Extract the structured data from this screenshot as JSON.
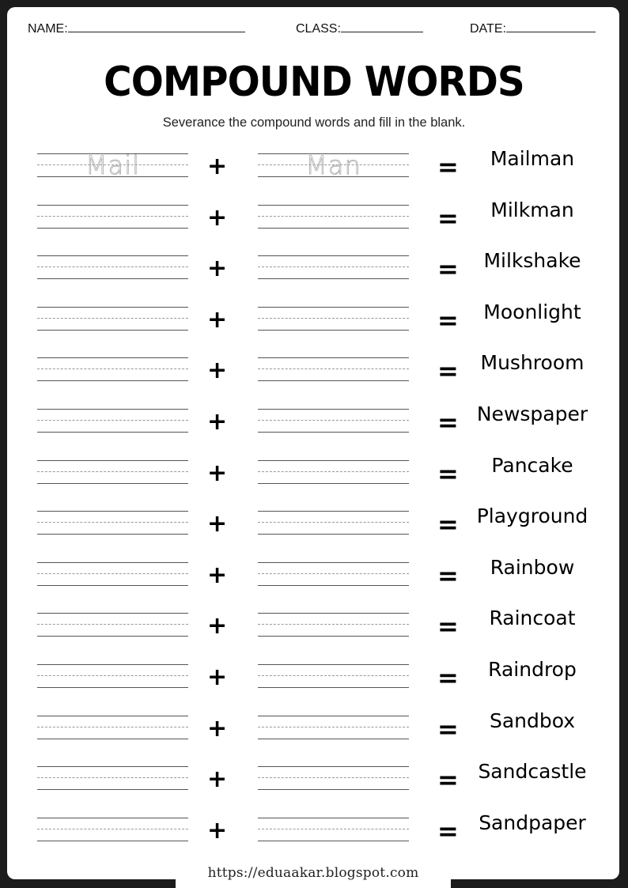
{
  "header": {
    "name_label": "NAME:",
    "class_label": "CLASS:",
    "date_label": "DATE:"
  },
  "title": "COMPOUND WORDS",
  "instruction": "Severance the compound words and fill in the blank.",
  "operators": {
    "plus": "+",
    "equals": "="
  },
  "rows": [
    {
      "part1": "Mail",
      "part2": "Man",
      "word": "Mailman"
    },
    {
      "part1": "",
      "part2": "",
      "word": "Milkman"
    },
    {
      "part1": "",
      "part2": "",
      "word": "Milkshake"
    },
    {
      "part1": "",
      "part2": "",
      "word": "Moonlight"
    },
    {
      "part1": "",
      "part2": "",
      "word": "Mushroom"
    },
    {
      "part1": "",
      "part2": "",
      "word": "Newspaper"
    },
    {
      "part1": "",
      "part2": "",
      "word": "Pancake"
    },
    {
      "part1": "",
      "part2": "",
      "word": "Playground"
    },
    {
      "part1": "",
      "part2": "",
      "word": "Rainbow"
    },
    {
      "part1": "",
      "part2": "",
      "word": "Raincoat"
    },
    {
      "part1": "",
      "part2": "",
      "word": "Raindrop"
    },
    {
      "part1": "",
      "part2": "",
      "word": "Sandbox"
    },
    {
      "part1": "",
      "part2": "",
      "word": "Sandcastle"
    },
    {
      "part1": "",
      "part2": "",
      "word": "Sandpaper"
    }
  ],
  "footer": {
    "url": "https://eduaakar.blogspot.com"
  },
  "colors": {
    "background": "#1c1c1c",
    "page": "#ffffff",
    "text": "#000000",
    "trace": "#aaaaaa"
  }
}
